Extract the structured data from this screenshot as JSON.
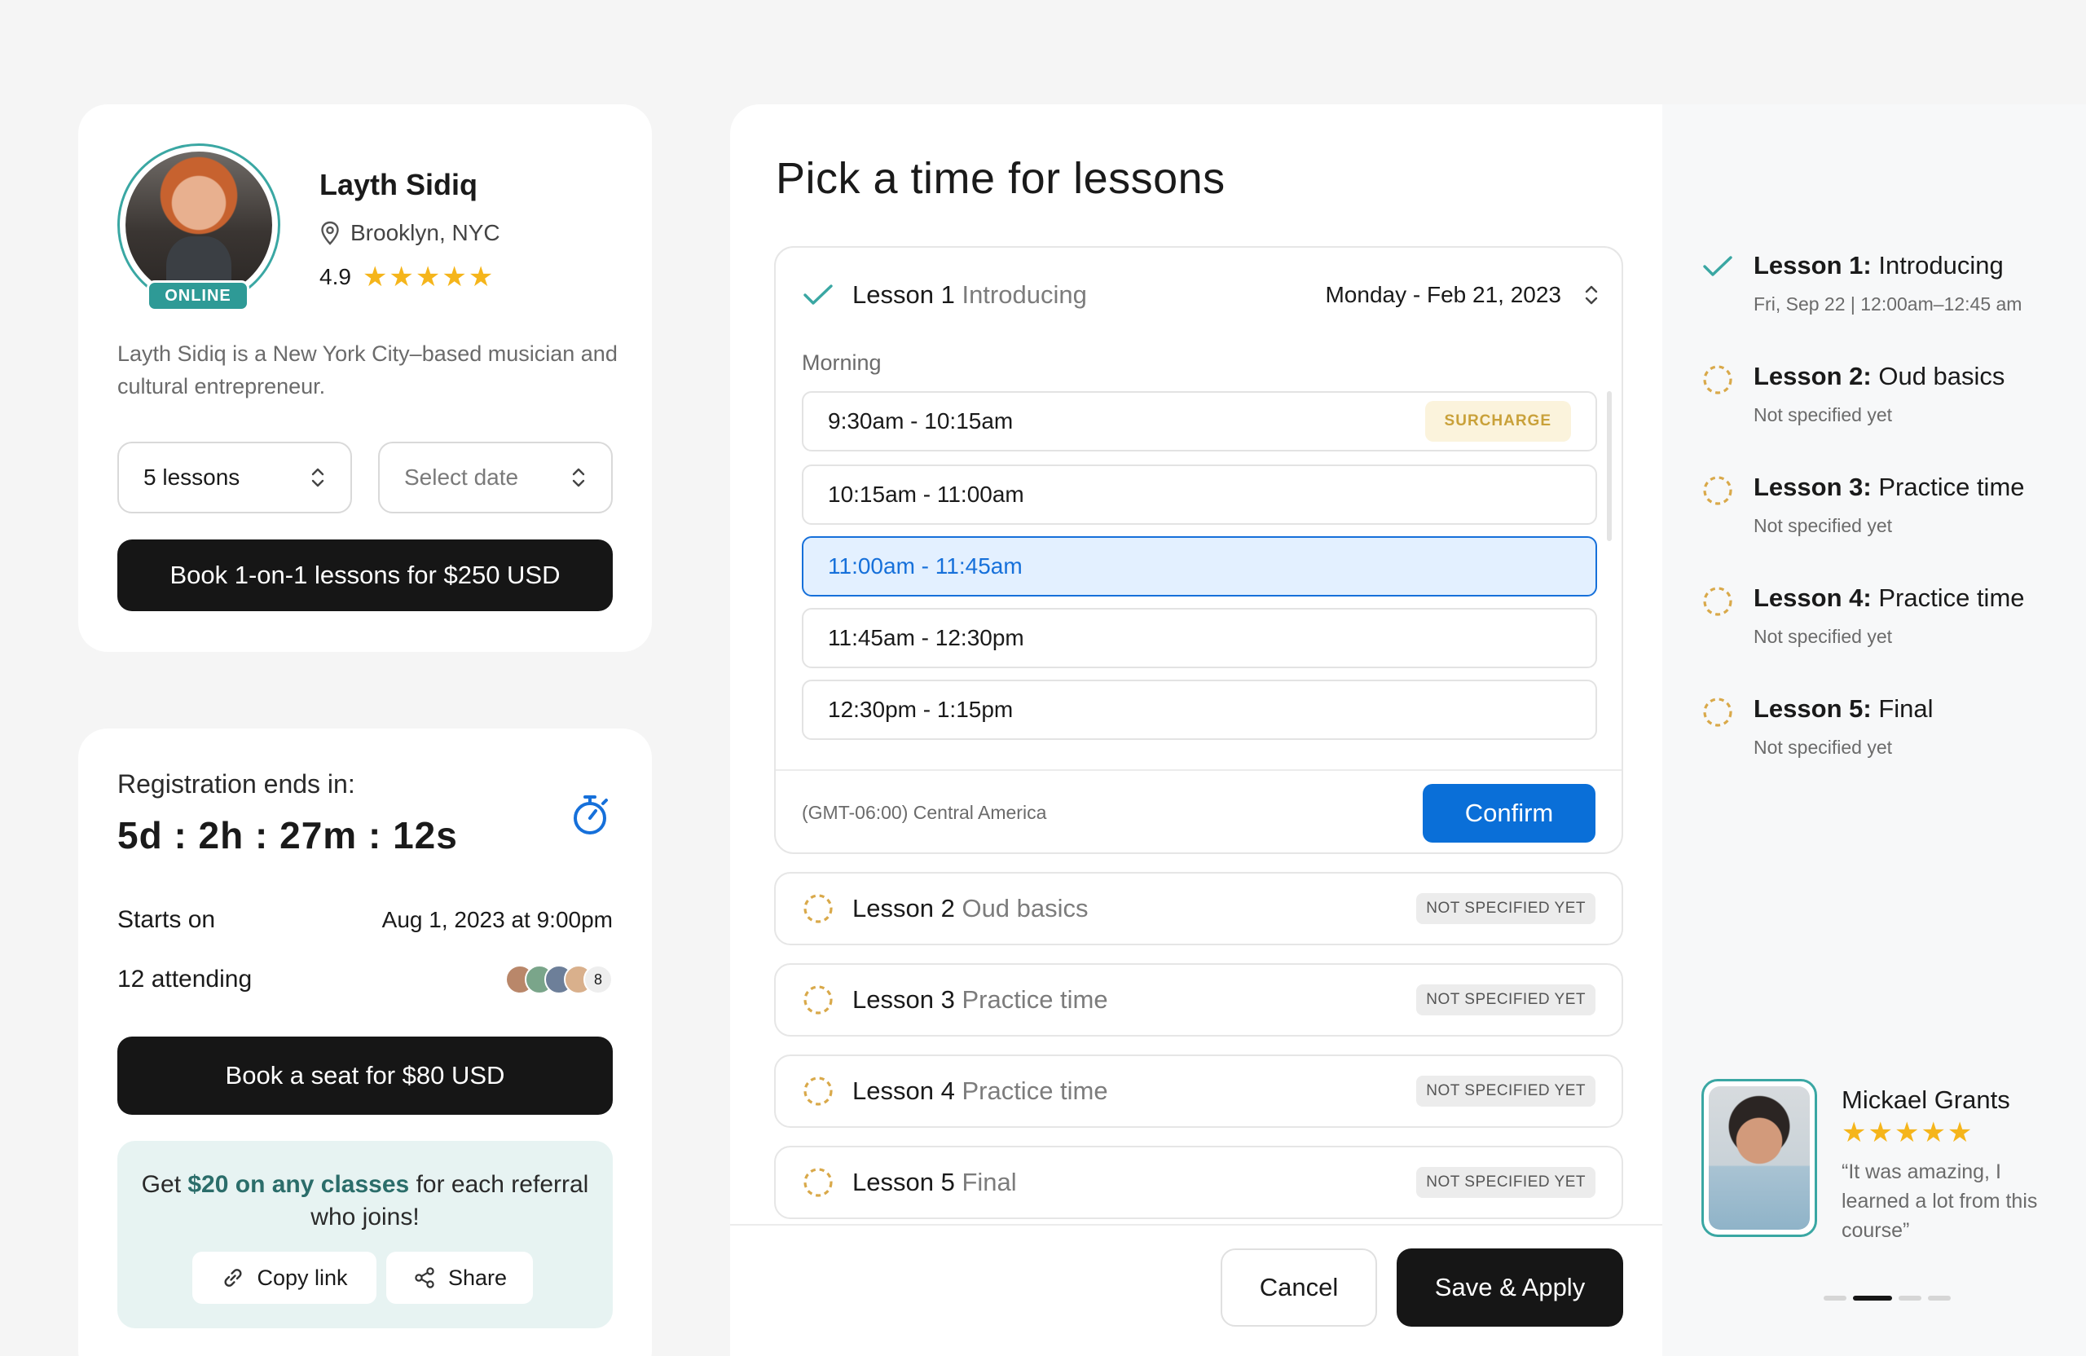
{
  "profile": {
    "name": "Layth Sidiq",
    "status": "ONLINE",
    "location": "Brooklyn, NYC",
    "rating": "4.9",
    "stars": "★★★★★",
    "bio": "Layth Sidiq is a New York City–based musician and cultural entrepreneur.",
    "lessons_select": "5 lessons",
    "date_select": "Select date",
    "book_label": "Book 1-on-1 lessons for $250 USD"
  },
  "registration": {
    "label": "Registration ends in:",
    "timer": "5d : 2h : 27m : 12s",
    "starts_label": "Starts on",
    "starts_value": "Aug 1, 2023 at 9:00pm",
    "attending_label": "12 attending",
    "attending_more": "8",
    "book_seat_label": "Book a seat for $80 USD",
    "referral_pre": "Get ",
    "referral_highlight": "$20 on any classes",
    "referral_post": " for each referral who joins!",
    "copy_link": "Copy link",
    "share": "Share"
  },
  "modal": {
    "title": "Pick a time for lessons",
    "active_lesson": {
      "number": "Lesson 1",
      "name": "Introducing",
      "date": "Monday - Feb 21, 2023",
      "period": "Morning",
      "slots": [
        {
          "time": "9:30am - 10:15am",
          "badge": "SURCHARGE"
        },
        {
          "time": "10:15am - 11:00am"
        },
        {
          "time": "11:00am - 11:45am"
        },
        {
          "time": "11:45am - 12:30pm"
        },
        {
          "time": "12:30pm - 1:15pm"
        }
      ],
      "timezone": "(GMT-06:00) Central America",
      "confirm": "Confirm"
    },
    "lessons": [
      {
        "number": "Lesson 2",
        "name": "Oud basics",
        "badge": "NOT SPECIFIED YET"
      },
      {
        "number": "Lesson 3",
        "name": "Practice time",
        "badge": "NOT SPECIFIED YET"
      },
      {
        "number": "Lesson 4",
        "name": "Practice time",
        "badge": "NOT SPECIFIED YET"
      },
      {
        "number": "Lesson 5",
        "name": "Final",
        "badge": "NOT SPECIFIED YET"
      }
    ],
    "cancel": "Cancel",
    "save": "Save & Apply"
  },
  "sidebar": {
    "steps": [
      {
        "label": "Lesson 1:",
        "name": "Introducing",
        "sub": "Fri, Sep 22 | 12:00am–12:45 am"
      },
      {
        "label": "Lesson 2:",
        "name": "Oud basics",
        "sub": "Not specified yet"
      },
      {
        "label": "Lesson 3:",
        "name": "Practice time",
        "sub": "Not specified yet"
      },
      {
        "label": "Lesson 4:",
        "name": "Practice time",
        "sub": "Not specified yet"
      },
      {
        "label": "Lesson 5:",
        "name": "Final",
        "sub": "Not specified yet"
      }
    ],
    "review": {
      "name": "Mickael Grants",
      "stars": "★★★★★",
      "quote": "“It was amazing, I learned a lot from this course”"
    }
  },
  "colors": {
    "accent_teal": "#3aa7a3",
    "primary_blue": "#0a6fd8",
    "star_gold": "#f5b51b",
    "pending_dash": "#d9a94a"
  }
}
